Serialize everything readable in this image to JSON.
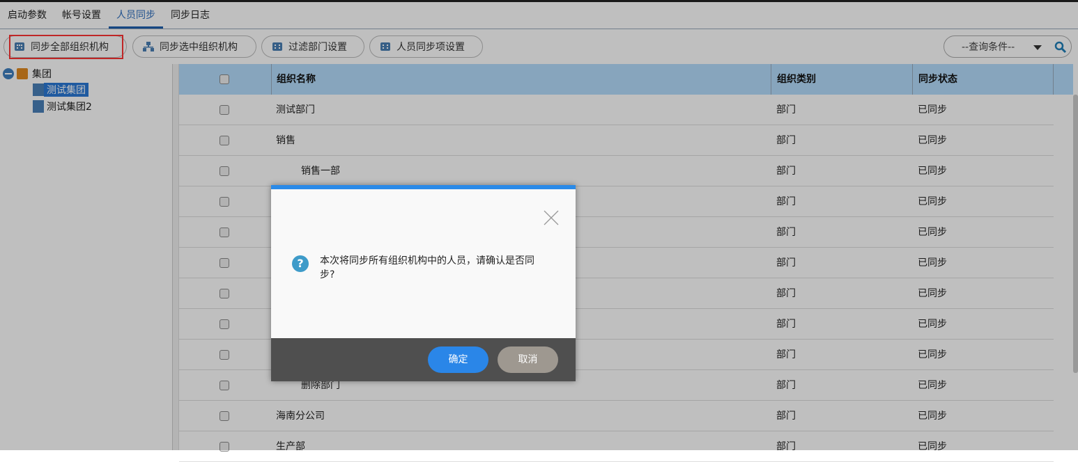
{
  "tabs": [
    "启动参数",
    "帐号设置",
    "人员同步",
    "同步日志"
  ],
  "toolbar": {
    "buttons": [
      "同步全部组织机构",
      "同步选中组织机构",
      "过滤部门设置",
      "人员同步项设置"
    ],
    "query_placeholder": "--查询条件--"
  },
  "tree": {
    "root": "集团",
    "children": [
      "测试集团",
      "测试集团2"
    ]
  },
  "grid": {
    "headers": [
      "组织名称",
      "组织类别",
      "同步状态"
    ],
    "rows": [
      {
        "name": "测试部门",
        "type": "部门",
        "status": "已同步"
      },
      {
        "name": "销售",
        "type": "部门",
        "status": "已同步"
      },
      {
        "name": "销售一部",
        "type": "部门",
        "status": "已同步"
      },
      {
        "name": "",
        "type": "部门",
        "status": "已同步"
      },
      {
        "name": "",
        "type": "部门",
        "status": "已同步"
      },
      {
        "name": "",
        "type": "部门",
        "status": "已同步"
      },
      {
        "name": "",
        "type": "部门",
        "status": "已同步"
      },
      {
        "name": "",
        "type": "部门",
        "status": "已同步"
      },
      {
        "name": "",
        "type": "部门",
        "status": "已同步"
      },
      {
        "name": "删除部门",
        "type": "部门",
        "status": "已同步"
      },
      {
        "name": "海南分公司",
        "type": "部门",
        "status": "已同步"
      },
      {
        "name": "生产部",
        "type": "部门",
        "status": "已同步"
      }
    ]
  },
  "dialog": {
    "message": "本次将同步所有组织机构中的人员，请确认是否同步?",
    "ok": "确定",
    "cancel": "取消"
  },
  "colors": {
    "accent": "#2a8ae8",
    "cancel": "#9e9890",
    "footer": "#4f4f4f"
  }
}
